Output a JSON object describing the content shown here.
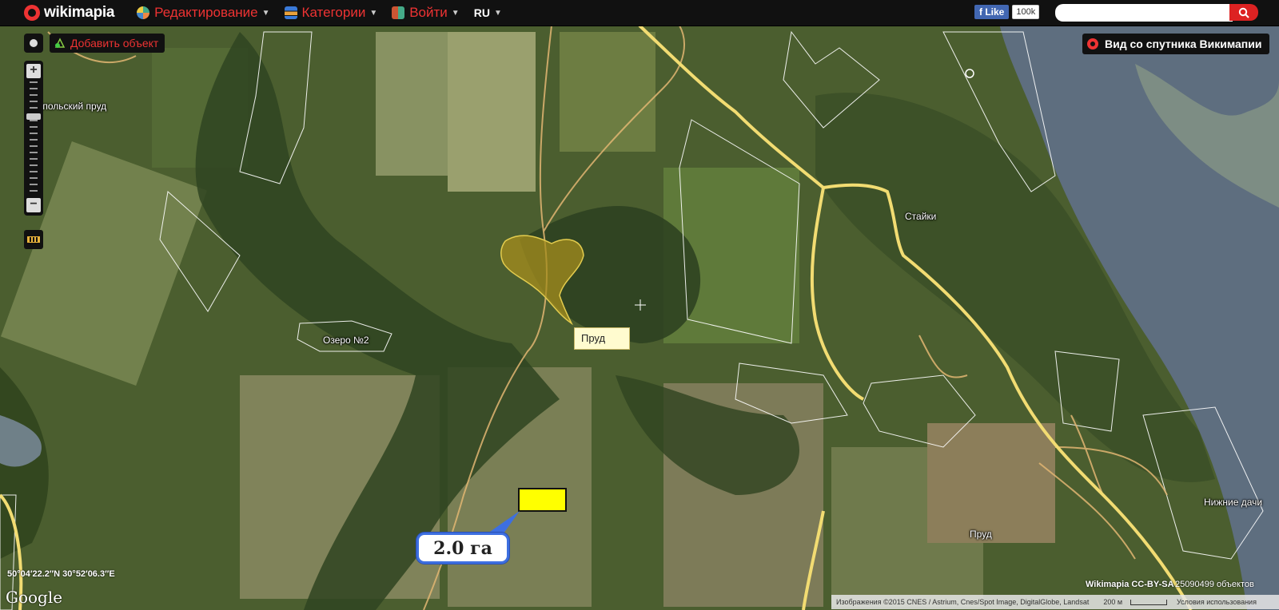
{
  "topbar": {
    "logo": "wikimapia",
    "menu": [
      {
        "label": "Редактирование"
      },
      {
        "label": "Категории"
      },
      {
        "label": "Войти"
      }
    ],
    "language": "RU",
    "facebook": {
      "like": "Like",
      "count": "100k"
    }
  },
  "controls": {
    "add_object": "Добавить объект",
    "satellite_view": "Вид со спутника Викимапии"
  },
  "map": {
    "labels": [
      {
        "text": "рипольский пруд"
      },
      {
        "text": "Озеро №2"
      },
      {
        "text": "Стайки"
      },
      {
        "text": "Нижние дачи"
      },
      {
        "text": "Пруд"
      }
    ],
    "tooltip": "Пруд",
    "area_callout": "2.0 га",
    "coordinates": "50°04′22.2″N 30°52′06.3″E"
  },
  "footer": {
    "google": "Google",
    "license": "Wikimapia CC-BY-SA",
    "object_count": "25090499 объектов",
    "imagery": "Изображения ©2015 CNES / Astrium, Cnes/Spot Image, DigitalGlobe, Landsat",
    "scale": "200 м",
    "terms": "Условия использования"
  },
  "colors": {
    "accent": "#e33333",
    "road": "#f2dc72",
    "pond": "#a68d1e",
    "water": "#5e6e7f",
    "callout_border": "#3d6fe0"
  }
}
